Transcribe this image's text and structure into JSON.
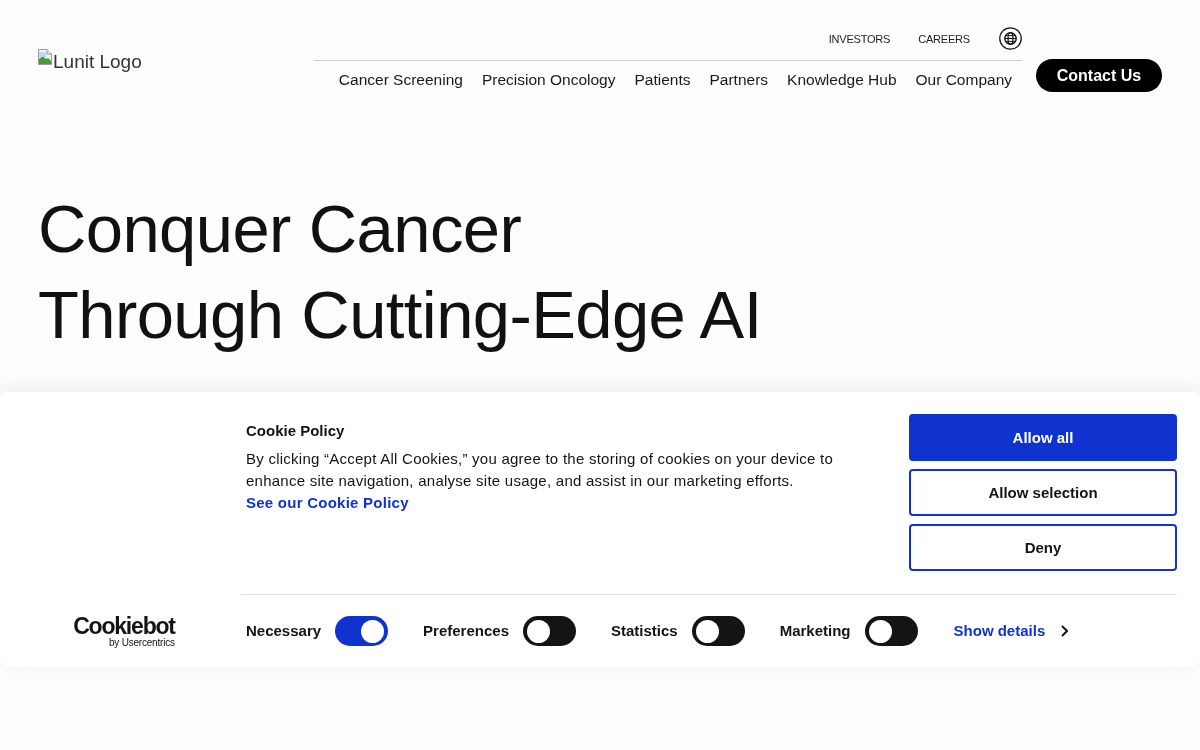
{
  "header": {
    "logo": {
      "alt_text": "Lunit Logo"
    },
    "utility_links": [
      "INVESTORS",
      "CAREERS"
    ],
    "nav": [
      "Cancer Screening",
      "Precision Oncology",
      "Patients",
      "Partners",
      "Knowledge Hub",
      "Our Company"
    ],
    "contact_button": "Contact Us"
  },
  "hero": {
    "title_lines": [
      "Conquer Cancer",
      "Through Cutting-Edge AI"
    ]
  },
  "cookie_banner": {
    "title": "Cookie Policy",
    "description": "By clicking “Accept All Cookies,” you agree to the storing of cookies on your device to enhance site navigation, analyse site usage, and assist in our marketing efforts.",
    "policy_link": "See our Cookie Policy",
    "buttons": [
      {
        "label": "Allow all",
        "kind": "primary"
      },
      {
        "label": "Allow selection",
        "kind": "outline"
      },
      {
        "label": "Deny",
        "kind": "outline"
      }
    ],
    "brand": {
      "wordmark": "Cookiebot",
      "tagline": "by Usercentrics"
    },
    "consents": [
      {
        "label": "Necessary",
        "checked": true
      },
      {
        "label": "Preferences",
        "checked": false
      },
      {
        "label": "Statistics",
        "checked": false
      },
      {
        "label": "Marketing",
        "checked": false
      }
    ],
    "details_link": "Show details"
  }
}
